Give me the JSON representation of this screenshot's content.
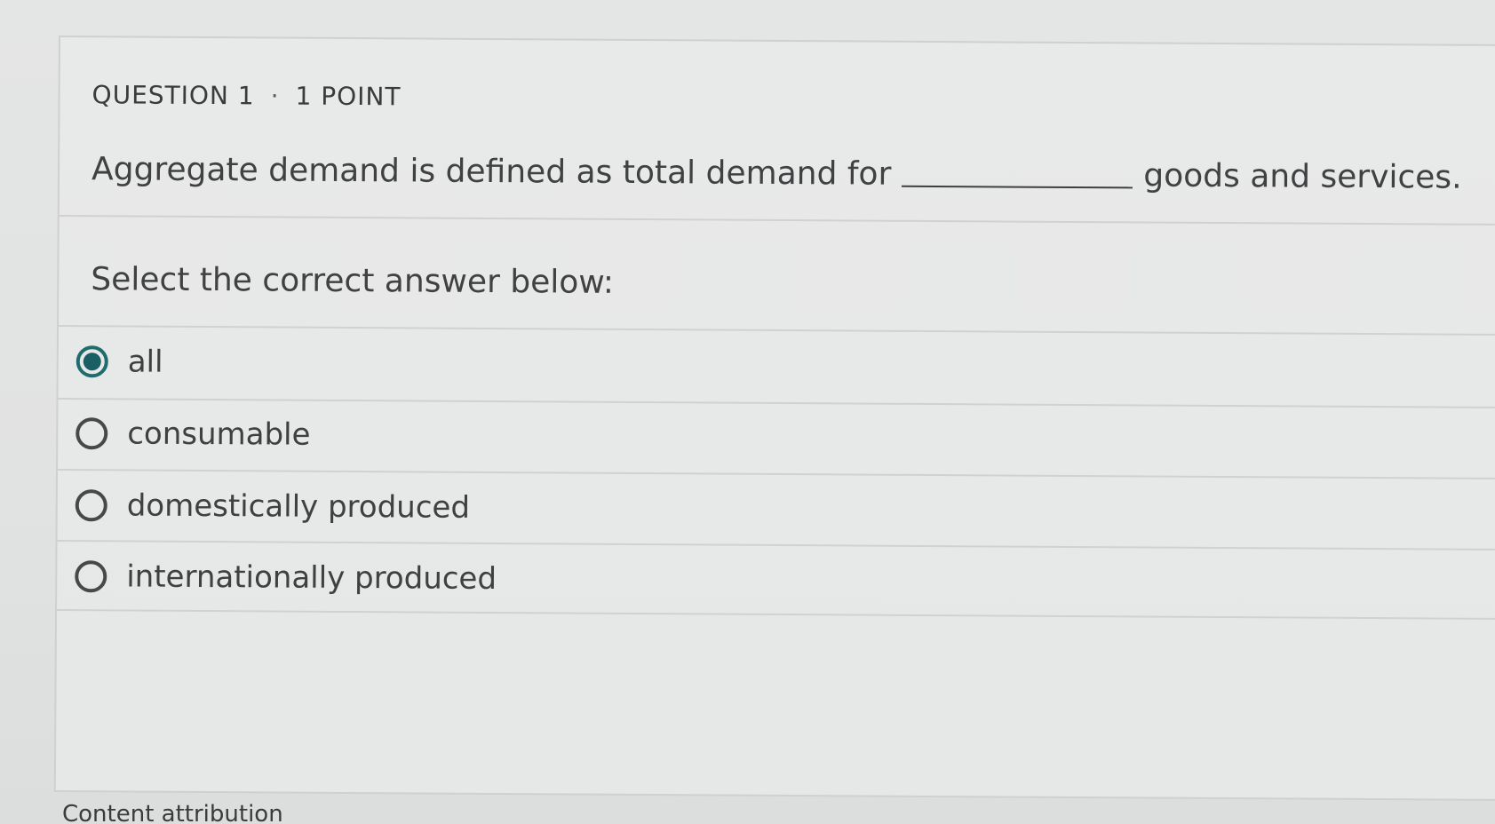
{
  "question": {
    "number_label": "QUESTION 1",
    "separator": "·",
    "points_label": "1 POINT",
    "stem_before": "Aggregate demand is defined as total demand for",
    "stem_after": "goods and services.",
    "prompt": "Select the correct answer below:"
  },
  "options": [
    {
      "label": "all",
      "selected": true
    },
    {
      "label": "consumable",
      "selected": false
    },
    {
      "label": "domestically produced",
      "selected": false
    },
    {
      "label": "internationally produced",
      "selected": false
    }
  ],
  "footer": {
    "attribution_label": "Content attribution"
  },
  "colors": {
    "selected_radio": "#1a5f63",
    "text": "#404142",
    "background": "#e4e5e5"
  }
}
